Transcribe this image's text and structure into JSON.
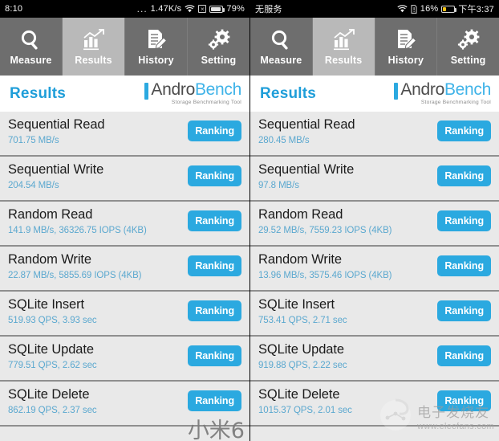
{
  "tabs": [
    {
      "label": "Measure",
      "icon": "magnifier-icon",
      "active": false
    },
    {
      "label": "Results",
      "icon": "chart-icon",
      "active": true
    },
    {
      "label": "History",
      "icon": "document-pencil-icon",
      "active": false
    },
    {
      "label": "Setting",
      "icon": "gears-icon",
      "active": false
    }
  ],
  "brand": {
    "name_first": "Andro",
    "name_second": "Bench",
    "tagline": "Storage Benchmarking Tool"
  },
  "page": {
    "title": "Results"
  },
  "ranking_label": "Ranking",
  "colors": {
    "accent_blue": "#2ba9e0",
    "title_blue": "#1f9ed9",
    "value_blue": "#5ba8cf",
    "row_bg": "#e9e9e9",
    "tabbar_bg": "#6e6e6e",
    "tab_active_bg": "#b9b9b9",
    "battery_low": "#f3c315"
  },
  "left_phone": {
    "status": {
      "time": "8:10",
      "dots": "...",
      "network_speed": "1.47K/s",
      "wifi_icon": "wifi-icon",
      "alert_icon": "boxed-x-icon",
      "battery_icon": "battery-icon",
      "battery_percent": "79%",
      "battery_level": 79,
      "battery_low": false
    },
    "rows": [
      {
        "title": "Sequential Read",
        "value": "701.75 MB/s"
      },
      {
        "title": "Sequential Write",
        "value": "204.54 MB/s"
      },
      {
        "title": "Random Read",
        "value": "141.9 MB/s, 36326.75 IOPS (4KB)"
      },
      {
        "title": "Random Write",
        "value": "22.87 MB/s, 5855.69 IOPS (4KB)"
      },
      {
        "title": "SQLite Insert",
        "value": "519.93 QPS, 3.93 sec"
      },
      {
        "title": "SQLite Update",
        "value": "779.51 QPS, 2.62 sec"
      },
      {
        "title": "SQLite Delete",
        "value": "862.19 QPS, 2.37 sec"
      }
    ],
    "watermark": {
      "text": "小米6"
    }
  },
  "right_phone": {
    "status": {
      "carrier": "无服务",
      "wifi_icon": "wifi-icon",
      "sim_icon": "sim-alert-icon",
      "battery_percent": "16%",
      "battery_level": 16,
      "battery_low": true,
      "battery_icon": "battery-icon",
      "time": "下午3:37"
    },
    "rows": [
      {
        "title": "Sequential Read",
        "value": "280.45 MB/s"
      },
      {
        "title": "Sequential Write",
        "value": "97.8 MB/s"
      },
      {
        "title": "Random Read",
        "value": "29.52 MB/s, 7559.23 IOPS (4KB)"
      },
      {
        "title": "Random Write",
        "value": "13.96 MB/s, 3575.46 IOPS (4KB)"
      },
      {
        "title": "SQLite Insert",
        "value": "753.41 QPS, 2.71 sec"
      },
      {
        "title": "SQLite Update",
        "value": "919.88 QPS, 2.22 sec"
      },
      {
        "title": "SQLite Delete",
        "value": "1015.37 QPS, 2.01 sec"
      }
    ],
    "watermark": {
      "cn": "电子发烧友",
      "url": "www.elecfans.com",
      "logo": "elecfans-logo-icon"
    }
  }
}
